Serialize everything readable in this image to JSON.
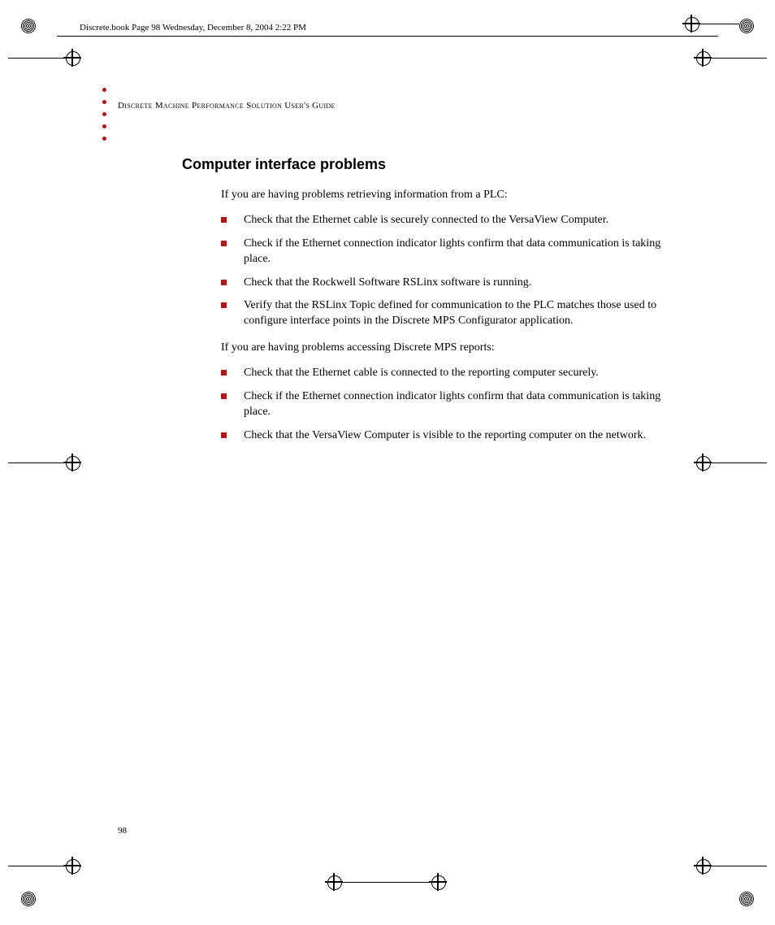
{
  "print_header": "Discrete.book  Page 98  Wednesday, December 8, 2004  2:22 PM",
  "running_head": "Discrete Machine Performance Solution User's Guide",
  "section_title": "Computer interface problems",
  "intro1": "If you are having problems retrieving information from a PLC:",
  "list1": [
    "Check that the Ethernet cable is securely connected to the VersaView Computer.",
    "Check if the Ethernet connection indicator lights confirm that data communication is taking place.",
    "Check that the Rockwell Software RSLinx software is running.",
    "Verify that the RSLinx Topic defined for communication to the PLC matches those used to configure interface points in the Discrete MPS Configurator application."
  ],
  "intro2": "If you are having problems accessing Discrete MPS reports:",
  "list2": [
    "Check that the Ethernet cable is connected to the reporting computer securely.",
    "Check if the Ethernet connection indicator lights confirm that data communication is taking place.",
    "Check that the VersaView Computer is visible to the reporting computer on the network."
  ],
  "page_number": "98"
}
